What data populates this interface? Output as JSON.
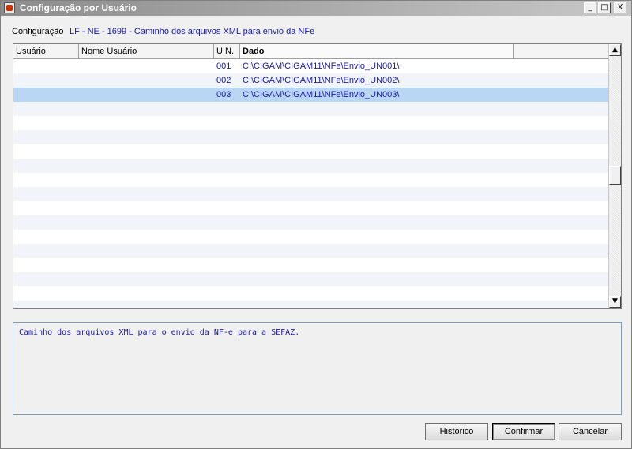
{
  "window": {
    "title": "Configuração por Usuário",
    "controls": {
      "minimize": "_",
      "maximize": "□",
      "close": "X"
    }
  },
  "config": {
    "label": "Configuração",
    "value": "LF - NE - 1699 - Caminho dos arquivos XML para envio da NFe"
  },
  "grid": {
    "columns": [
      "Usuário",
      "Nome Usuário",
      "U.N.",
      "Dado",
      ""
    ],
    "sorted_column": "Dado",
    "rows": [
      {
        "usuario": "",
        "nome": "",
        "un": "001",
        "dado": "C:\\CIGAM\\CIGAM11\\NFe\\Envio_UN001\\"
      },
      {
        "usuario": "",
        "nome": "",
        "un": "002",
        "dado": "C:\\CIGAM\\CIGAM11\\NFe\\Envio_UN002\\"
      },
      {
        "usuario": "",
        "nome": "",
        "un": "003",
        "dado": "C:\\CIGAM\\CIGAM11\\NFe\\Envio_UN003\\"
      }
    ],
    "selected_row": 2,
    "colors": {
      "selected": "#b9d7f5",
      "alt_row": "#f1f4f9",
      "text": "#1a1aaa"
    }
  },
  "description": "Caminho dos arquivos XML para o envio da NF-e para a SEFAZ.",
  "buttons": {
    "historico": "Histórico",
    "confirmar": "Confirmar",
    "cancelar": "Cancelar"
  }
}
